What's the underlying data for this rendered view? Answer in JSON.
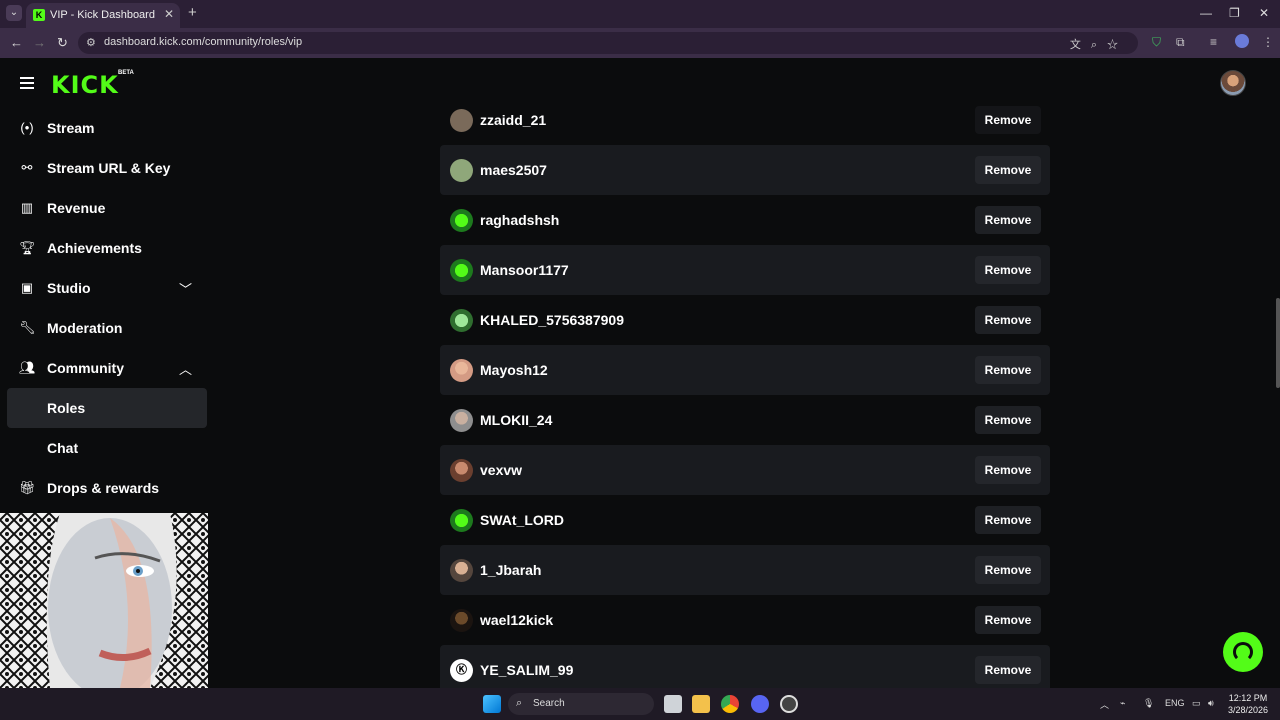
{
  "browser": {
    "tab_title": "VIP - Kick Dashboard",
    "url": "dashboard.kick.com/community/roles/vip"
  },
  "header": {
    "logo": "KICK",
    "logo_badge": "BETA"
  },
  "sidebar": {
    "items": [
      {
        "label": "Stream",
        "icon": "broadcast-icon"
      },
      {
        "label": "Stream URL & Key",
        "icon": "link-icon"
      },
      {
        "label": "Revenue",
        "icon": "chart-icon"
      },
      {
        "label": "Achievements",
        "icon": "trophy-icon"
      },
      {
        "label": "Studio",
        "icon": "studio-icon"
      },
      {
        "label": "Moderation",
        "icon": "wrench-icon"
      },
      {
        "label": "Community",
        "icon": "users-icon"
      },
      {
        "label": "Roles"
      },
      {
        "label": "Chat"
      },
      {
        "label": "Drops & rewards",
        "icon": "gift-icon"
      }
    ]
  },
  "vip_list": {
    "remove_label": "Remove",
    "users": [
      {
        "username": "zzaidd_21"
      },
      {
        "username": "maes2507"
      },
      {
        "username": "raghadshsh"
      },
      {
        "username": "Mansoor1177"
      },
      {
        "username": "KHALED_5756387909"
      },
      {
        "username": "Mayosh12"
      },
      {
        "username": "MLOKII_24"
      },
      {
        "username": "vexvw"
      },
      {
        "username": "SWAt_LORD"
      },
      {
        "username": "1_Jbarah"
      },
      {
        "username": "wael12kick"
      },
      {
        "username": "YE_SALIM_99"
      }
    ]
  },
  "taskbar": {
    "search_label": "Search",
    "language": "ENG",
    "time": "12:12 PM",
    "date": "3/28/2026"
  },
  "colors": {
    "brand": "#53fc18",
    "background": "#0b0c0d",
    "row_alt": "#191b1f"
  }
}
